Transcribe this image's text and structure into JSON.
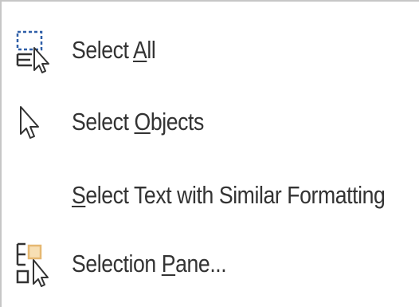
{
  "menu": {
    "items": [
      {
        "pre": "Select ",
        "key": "A",
        "post": "ll",
        "icon": "select-all-icon"
      },
      {
        "pre": "Select ",
        "key": "O",
        "post": "bjects",
        "icon": "select-objects-icon"
      },
      {
        "pre": "",
        "key": "S",
        "post": "elect Text with Similar Formatting",
        "icon": ""
      },
      {
        "pre": "Selection ",
        "key": "P",
        "post": "ane...",
        "icon": "selection-pane-icon"
      }
    ]
  },
  "colors": {
    "text": "#333333",
    "icon_blue": "#2f5fa8",
    "icon_gold": "#e6b872",
    "border": "#c6c6c6"
  }
}
